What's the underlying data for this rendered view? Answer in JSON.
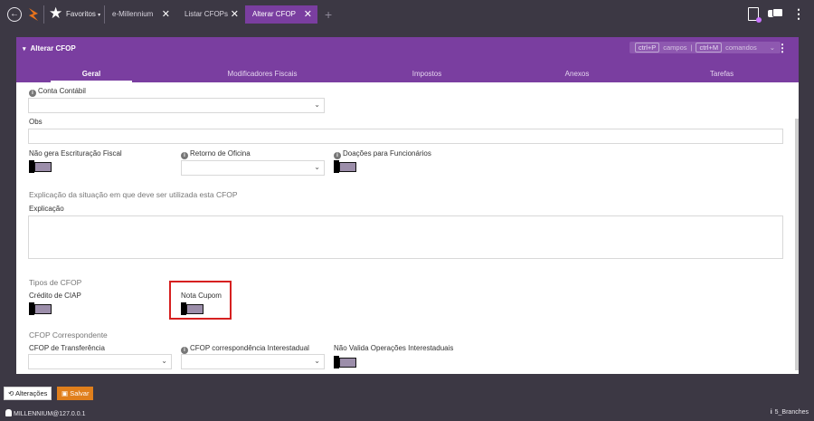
{
  "topbar": {
    "favorites_label": "Favoritos",
    "favorites_caret": "▾",
    "tabs": [
      {
        "label": "e-Millennium",
        "close": "✕"
      },
      {
        "label": "Listar CFOPs",
        "close": "✕"
      },
      {
        "label": "Alterar CFOP",
        "close": "✕"
      }
    ],
    "add_tab": "+"
  },
  "panel": {
    "title": "Alterar CFOP",
    "caret": "▾",
    "shortcuts": {
      "key1": "ctrl+P",
      "label1": "campos",
      "divider": "|",
      "key2": "ctrl+M",
      "label2": "comandos",
      "chevron": "⌄"
    },
    "menu": "⋮",
    "tabs": [
      "Geral",
      "Modificadores Fiscais",
      "Impostos",
      "Anexos",
      "Tarefas"
    ]
  },
  "form": {
    "conta_contabil_label": "Conta Contábil",
    "obs_label": "Obs",
    "nao_gera_label": "Não gera Escrituração Fiscal",
    "retorno_label": "Retorno de Oficina",
    "doacoes_label": "Doações para Funcionários",
    "explicacao_section": "Explicação da situação em que deve ser utilizada esta CFOP",
    "explicacao_label": "Explicação",
    "tipos_section": "Tipos de CFOP",
    "credito_ciap_label": "Crédito de CIAP",
    "nota_cupom_label": "Nota Cupom",
    "correspondente_section": "CFOP Correspondente",
    "transferencia_label": "CFOP de Transferência",
    "interestadual_label": "CFOP correspondência Interestadual",
    "nao_valida_label": "Não Valida Operações Interestaduais",
    "select_arrow": "⌄",
    "info_glyph": "i"
  },
  "bottom": {
    "alteracoes_label": "Alterações",
    "salvar_label": "Salvar",
    "connection": "MILLENNIUM@127.0.0.1",
    "branch": "5_Branches"
  }
}
